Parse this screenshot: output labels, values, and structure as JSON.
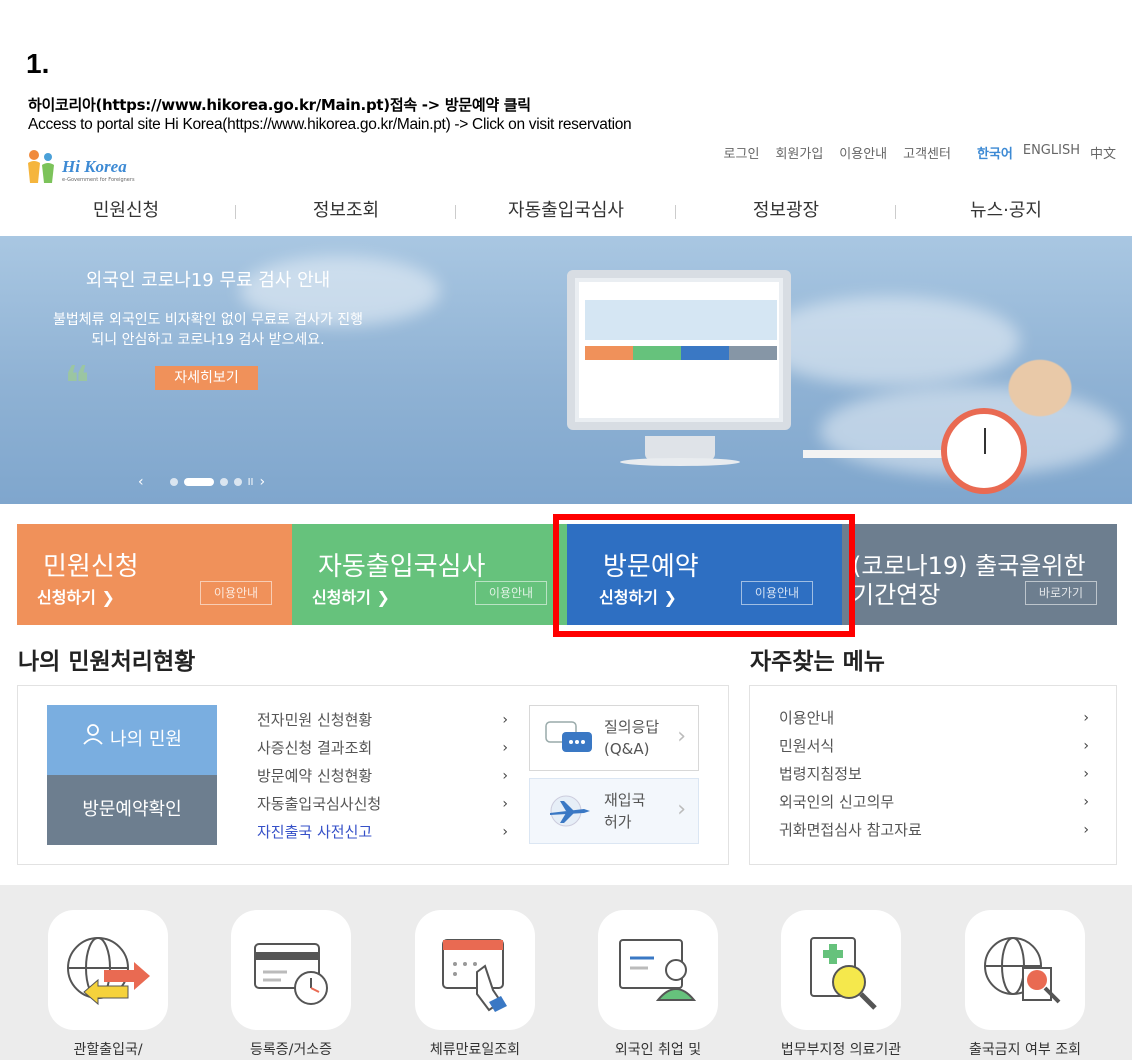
{
  "step": {
    "number": "1."
  },
  "instruction": {
    "ko": "하이코리아(https://www.hikorea.go.kr/Main.pt)접속 -> 방문예약 클릭",
    "en": "Access to portal site Hi Korea(https://www.hikorea.go.kr/Main.pt) -> Click on visit reservation"
  },
  "header": {
    "logo_text": "Hi Korea",
    "logo_tagline": "e-Government for Foreigners",
    "util_links": [
      "로그인",
      "회원가입",
      "이용안내",
      "고객센터"
    ],
    "languages": [
      "한국어",
      "ENGLISH",
      "中文"
    ]
  },
  "gnb": [
    "민원신청",
    "정보조회",
    "자동출입국심사",
    "정보광장",
    "뉴스·공지"
  ],
  "banner": {
    "title": "외국인 코로나19 무료 검사 안내",
    "text_line1": "불법체류 외국인도 비자확인 없이 무료로 검사가 진행",
    "text_line2": "되니 안심하고 코로나19 검사 받으세요.",
    "detail_button": "자세히보기",
    "prev": "‹",
    "next": "›",
    "pause": "II"
  },
  "quick_menu": [
    {
      "title": "민원신청",
      "sub": "신청하기 ❯",
      "btn": "이용안내",
      "color": "#f0915a"
    },
    {
      "title": "자동출입국심사",
      "sub": "신청하기 ❯",
      "btn": "이용안내",
      "color": "#66c27c"
    },
    {
      "title": "방문예약",
      "sub": "신청하기 ❯",
      "btn": "이용안내",
      "color": "#2e6fc2"
    },
    {
      "title_line1": "(코로나19) 출국을위한",
      "title_line2": "기간연장",
      "btn": "바로가기",
      "color": "#6d7e8f"
    }
  ],
  "my_status": {
    "title": "나의 민원처리현황",
    "my_button": "나의 민원",
    "reserve_button": "방문예약확인",
    "links": [
      "전자민원 신청현황",
      "사증신청 결과조회",
      "방문예약 신청현황",
      "자동출입국심사신청",
      "자진출국 사전신고"
    ],
    "arrow": "›",
    "cards": [
      {
        "line1": "질의응답",
        "line2": "(Q&A)"
      },
      {
        "line1": "재입국",
        "line2": "허가"
      }
    ]
  },
  "frequent_menu": {
    "title": "자주찾는 메뉴",
    "items": [
      "이용안내",
      "민원서식",
      "법령지침정보",
      "외국인의 신고의무",
      "귀화면접심사 참고자료"
    ],
    "arrow": "›"
  },
  "bottom_icons": [
    {
      "label": "관할출입국/",
      "icon": "globe-exchange-icon"
    },
    {
      "label": "등록증/거소증",
      "icon": "card-clock-icon"
    },
    {
      "label": "체류만료일조회",
      "icon": "calendar-touch-icon"
    },
    {
      "label": "외국인 취업 및",
      "icon": "worker-screen-icon"
    },
    {
      "label": "법무부지정 의료기관",
      "icon": "medical-search-icon"
    },
    {
      "label": "출국금지 여부 조회",
      "icon": "globe-person-search-icon"
    }
  ],
  "colors": {
    "accent_blue": "#3d8ad4",
    "highlight_red": "#ff0000",
    "orange": "#f0915a",
    "green": "#66c27c",
    "blue": "#2e6fc2",
    "slate": "#6d7e8f"
  }
}
